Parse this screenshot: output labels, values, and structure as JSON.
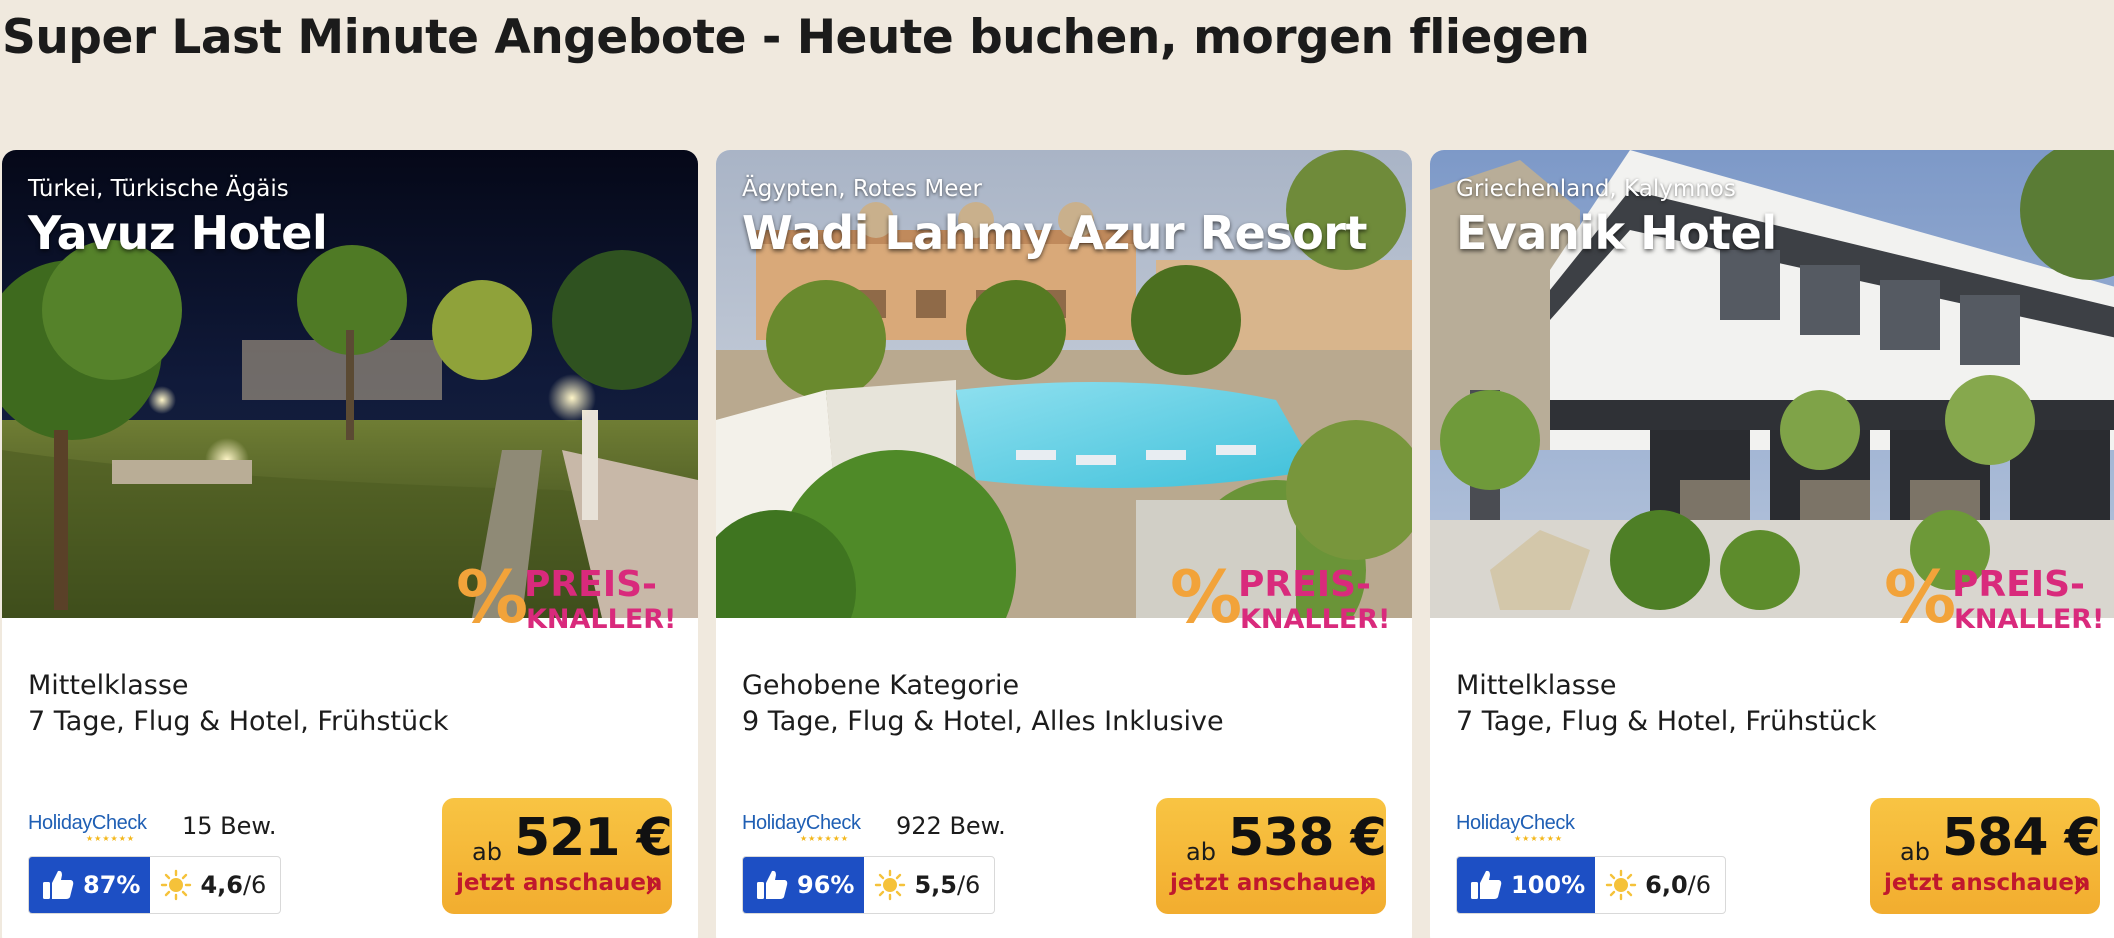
{
  "page": {
    "title": "Super Last Minute Angebote - Heute buchen, morgen fliegen"
  },
  "colors": {
    "background": "#f0e9de",
    "price_button": "#f4b93a",
    "cta_text": "#c0182d",
    "recommendation": "#1d4fc4",
    "holidaycheck_brand": "#1f5fb4"
  },
  "badge": {
    "line1": "PREIS-",
    "line2": "KNALLER!",
    "symbol": "%"
  },
  "holidaycheck": {
    "logo_text": "HolidayCheck",
    "stars": "★★★★★★"
  },
  "cards": [
    {
      "region": "Türkei, Türkische Ägäis",
      "name": "Yavuz Hotel",
      "category": "Mittelklasse",
      "details": "7 Tage, Flug & Hotel, Frühstück",
      "reviews": "15 Bew.",
      "recommendation": "87%",
      "sun_score": "4,6",
      "sun_max": "/6",
      "price_prefix": "ab",
      "price": "521 €",
      "cta": "jetzt anschauen",
      "image_icon": "hotel-garden-night-photo"
    },
    {
      "region": "Ägypten, Rotes Meer",
      "name": "Wadi Lahmy Azur Resort",
      "category": "Gehobene Kategorie",
      "details": "9 Tage, Flug & Hotel, Alles Inklusive",
      "reviews": "922 Bew.",
      "recommendation": "96%",
      "sun_score": "5,5",
      "sun_max": "/6",
      "price_prefix": "ab",
      "price": "538 €",
      "cta": "jetzt anschauen",
      "image_icon": "resort-pool-photo"
    },
    {
      "region": "Griechenland, Kalymnos",
      "name": "Evanik Hotel",
      "category": "Mittelklasse",
      "details": "7 Tage, Flug & Hotel, Frühstück",
      "reviews": "",
      "recommendation": "100%",
      "sun_score": "6,0",
      "sun_max": "/6",
      "price_prefix": "ab",
      "price": "584 €",
      "cta": "jetzt anschauen",
      "image_icon": "modern-hotel-terrace-photo"
    }
  ]
}
